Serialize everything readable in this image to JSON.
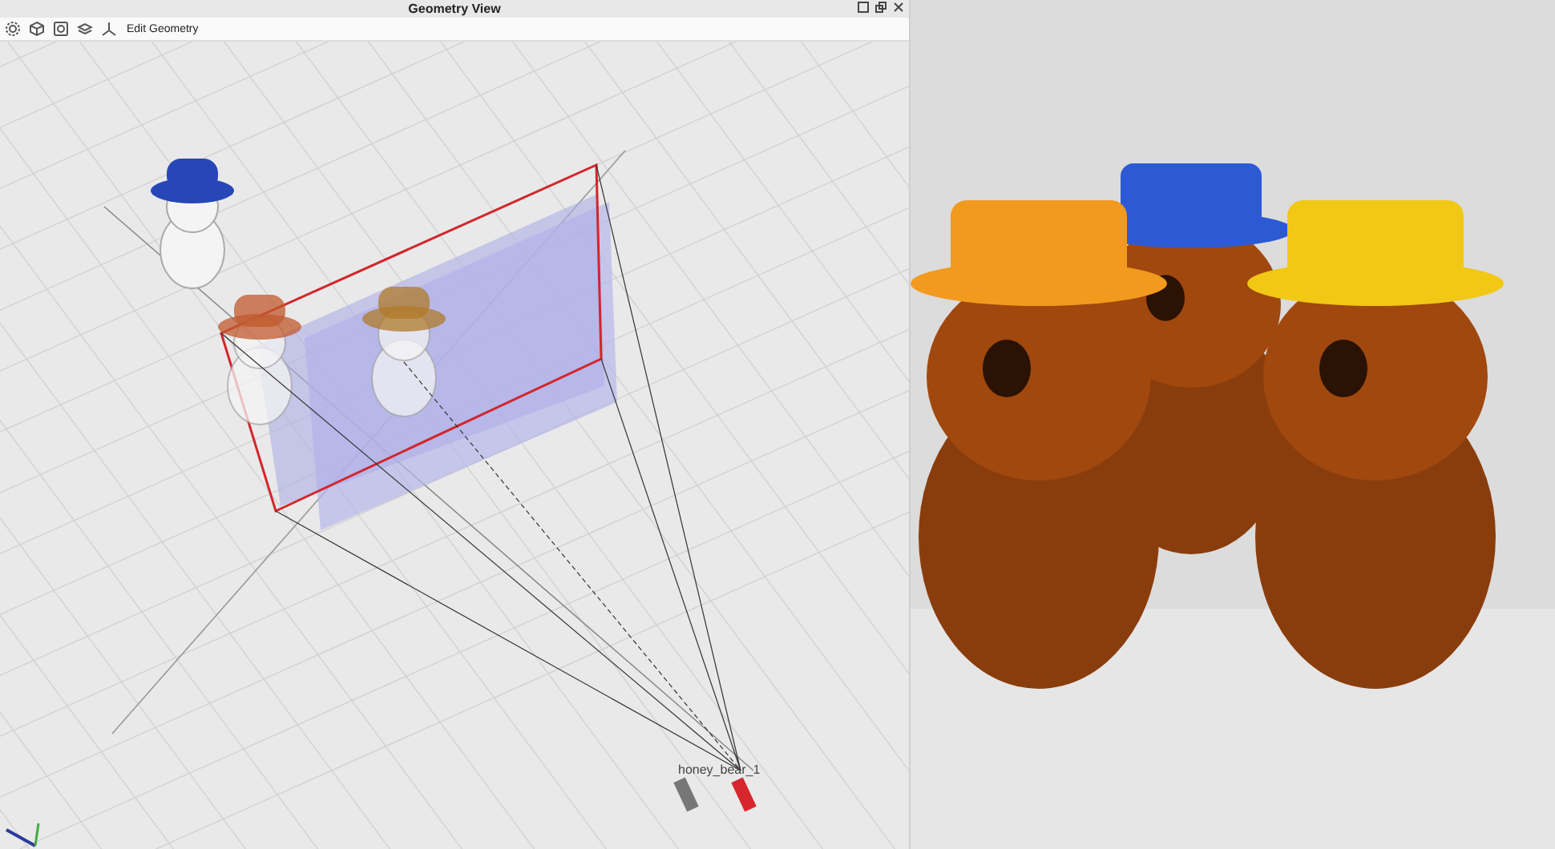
{
  "window": {
    "title": "Geometry View"
  },
  "toolbar": {
    "items": [
      {
        "kind": "gear"
      },
      {
        "kind": "cube"
      },
      {
        "kind": "frame"
      },
      {
        "kind": "layers"
      },
      {
        "kind": "axes"
      },
      {
        "kind": "text",
        "label": "Edit Geometry"
      }
    ]
  },
  "viewport": {
    "camera_label": "honey_bear_1"
  }
}
